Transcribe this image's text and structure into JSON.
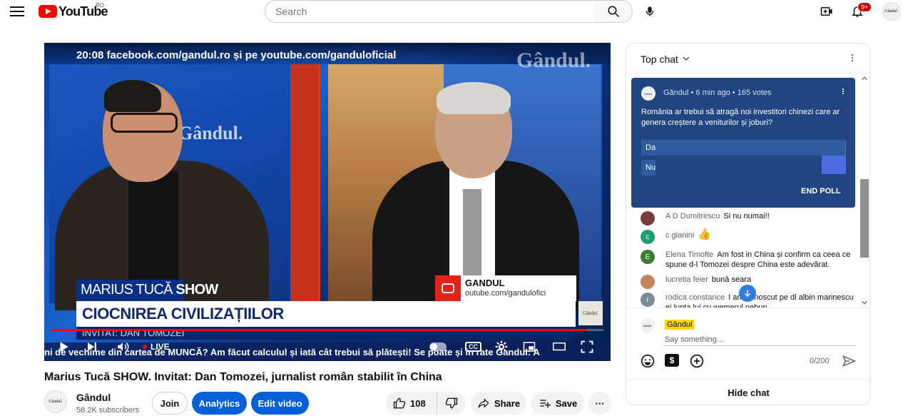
{
  "header": {
    "logo_text": "YouTube",
    "country_code": "RO",
    "search_placeholder": "Search",
    "notification_count": "9+",
    "avatar_text": "Gândul."
  },
  "video": {
    "topline": "20:08 facebook.com/gandul.ro și pe youtube.com/ganduloficial",
    "bg_logo": "Gândul.",
    "panel_logo": "Gândul.",
    "show_name_left": "MARIUS TUCĂ ",
    "show_name_right": "SHOW",
    "lower_title": "CIOCNIREA CIVILIZAȚIILOR",
    "lower_guest": "INVITAT: DAN TOMOZEI",
    "tag_name": "GANDUL",
    "tag_url": "outube.com/gandulofici",
    "small_logo": "Gândul.",
    "ticker": "ni de vechime din cartea de MUNCĂ? Am făcut calculul și iată cât trebui să plătești! Se poate și în rate  Gandul: A",
    "live_label": "LIVE",
    "cc_label": "CC",
    "progress": 0.97
  },
  "details": {
    "title": "Marius Tucă SHOW. Invitat: Dan Tomozei, jurnalist român stabilit în China",
    "channel_name": "Gândul",
    "subscribers": "58.2K subscribers",
    "channel_avatar": "Gândul.",
    "join_label": "Join",
    "analytics_label": "Analytics",
    "edit_label": "Edit video",
    "like_count": "108",
    "share_label": "Share",
    "save_label": "Save",
    "more_label": "···"
  },
  "chat": {
    "title": "Top chat",
    "poll": {
      "avatar": "Gândul.",
      "meta": "Gândul • 6 min ago • 165 votes",
      "question": "România ar trebui să atragă noi investitori chinezi care ar genera creștere a veniturilor și joburi?",
      "options": [
        {
          "label": "Da",
          "share": 0.95
        },
        {
          "label": "Nu",
          "share": 0.05
        }
      ],
      "end_label": "END POLL"
    },
    "messages": [
      {
        "author": "A D Dumitrescu",
        "text": "Si nu numai!!",
        "avatar_color": "#7a3b3b",
        "initial": ""
      },
      {
        "author": "c gianini",
        "text": "👍",
        "avatar_color": "#1e9c74",
        "initial": "c"
      },
      {
        "author": "Elena Timofte",
        "text": "Am fost in China și confirm ca ceea ce spune d-l Tomozei despre China este adevărat.",
        "avatar_color": "#3a7d2c",
        "initial": "E"
      },
      {
        "author": "lucretia feier",
        "text": "bună seara",
        "avatar_color": "#c4835a",
        "initial": ""
      },
      {
        "author": "rodica constance",
        "text": "I am cunoscut pe dl albin marinescu ei lupta lui cu wemerul nebun",
        "avatar_color": "#7b8b95",
        "initial": "r"
      }
    ],
    "input_name": "Gândul",
    "input_avatar": "Gândul.",
    "input_placeholder": "Say something...",
    "char_count": "0/200",
    "money_icon": "$",
    "hide_label": "Hide chat"
  },
  "icons": {
    "menu": "menu-icon",
    "search": "search-icon",
    "mic": "mic-icon",
    "create": "create-icon",
    "bell": "bell-icon",
    "play": "play-icon",
    "next": "next-icon",
    "volume": "volume-icon",
    "settings": "gear-icon",
    "miniplayer": "miniplayer-icon",
    "theater": "theater-icon",
    "fullscreen": "fullscreen-icon",
    "like": "thumbs-up-icon",
    "dislike": "thumbs-down-icon",
    "share": "share-icon",
    "save": "playlist-add-icon",
    "chevron": "chevron-down-icon",
    "more": "more-vert-icon",
    "emoji": "emoji-icon",
    "add": "add-circle-icon",
    "send": "send-icon"
  },
  "colors": {
    "brand_red": "#ff0000",
    "primary_blue": "#065fd4",
    "poll_bg": "#204580",
    "name_highlight": "#ffd600"
  }
}
